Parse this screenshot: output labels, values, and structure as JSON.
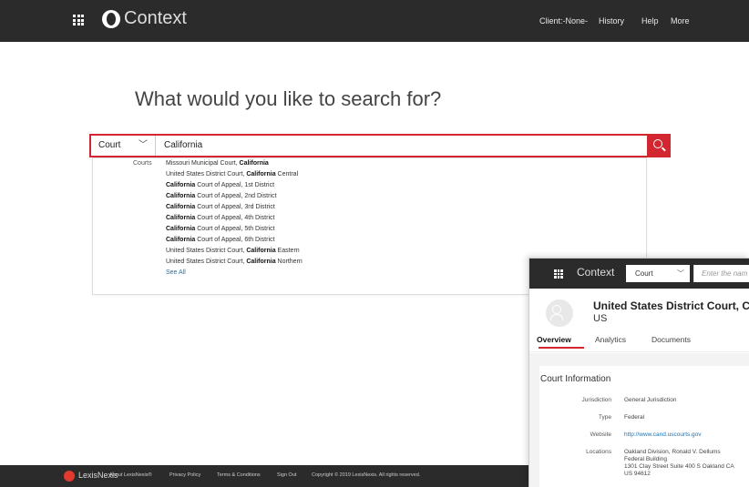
{
  "header": {
    "brand": "Context",
    "nav": [
      "Client:-None-",
      "History",
      "Help",
      "More"
    ]
  },
  "headline": "What would you like to search for?",
  "search": {
    "type_value": "Court",
    "query": "California"
  },
  "dropdown": {
    "group_label": "Courts",
    "items": [
      {
        "pre": "Missouri Municipal Court, ",
        "bold": "California",
        "post": ""
      },
      {
        "pre": "United States District Court, ",
        "bold": "California",
        "post": " Central"
      },
      {
        "pre": "",
        "bold": "California",
        "post": " Court of Appeal, 1st District"
      },
      {
        "pre": "",
        "bold": "California",
        "post": " Court of Appeal, 2nd District"
      },
      {
        "pre": "",
        "bold": "California",
        "post": " Court of Appeal, 3rd District"
      },
      {
        "pre": "",
        "bold": "California",
        "post": " Court of Appeal, 4th District"
      },
      {
        "pre": "",
        "bold": "California",
        "post": " Court of Appeal, 5th District"
      },
      {
        "pre": "",
        "bold": "California",
        "post": " Court of Appeal, 6th District"
      },
      {
        "pre": "United States District Court, ",
        "bold": "California",
        "post": " Eastern"
      },
      {
        "pre": "United States District Court, ",
        "bold": "California",
        "post": " Northern"
      }
    ],
    "see_all": "See All"
  },
  "footer": {
    "brand": "LexisNexis",
    "links": [
      "About LexisNexis®",
      "Privacy Policy",
      "Terms & Conditions",
      "Sign Out",
      "Copyright © 2019 LexisNexis. All rights reserved."
    ]
  },
  "panel": {
    "brand": "Context",
    "court_value": "Court",
    "input_placeholder": "Enter the nam",
    "title": "United States District Court, Ca",
    "country": "US",
    "tabs": [
      "Overview",
      "Analytics",
      "Documents"
    ],
    "section_title": "Court Information",
    "info": {
      "jurisdiction_label": "Jurisdiction",
      "jurisdiction": "General Jurisdiction",
      "type_label": "Type",
      "type": "Federal",
      "website_label": "Website",
      "website": "http://www.cand.uscourts.gov",
      "locations_label": "Locations",
      "locations": [
        "Oakland Division, Ronald V. Dellums",
        "Federal Building",
        "1301 Clay Street Suite 400 S Oakland CA",
        "US 94612"
      ]
    }
  },
  "colors": {
    "accent": "#d22630",
    "topbar": "#2b2b2b",
    "link": "#1a73b8"
  }
}
